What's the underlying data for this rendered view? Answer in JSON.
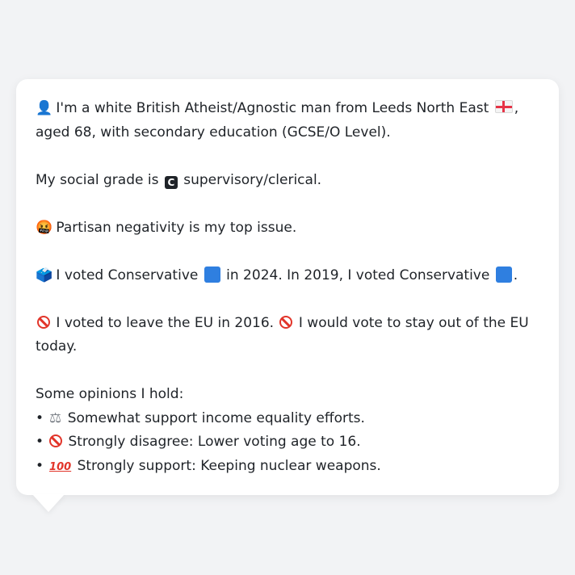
{
  "profile": {
    "intro_pre": "I'm a white British Atheist/Agnostic man from Leeds North East",
    "intro_post": ", aged 68, with secondary education (GCSE/O Level).",
    "social_grade_pre": "My social grade is",
    "social_grade_letter": "C",
    "social_grade_post": "supervisory/clerical.",
    "top_issue": "Partisan negativity is my top issue.",
    "vote_2024_pre": "I voted Conservative",
    "vote_2024_post": "in 2024. In 2019, I voted Conservative",
    "vote_end": ".",
    "eu_2016": "I voted to leave the EU in 2016.",
    "eu_today": "I would vote to stay out of the EU today.",
    "opinions_heading": "Some opinions I hold:",
    "opinions": [
      {
        "icon": "balance-scale-icon",
        "text": "Somewhat support income equality efforts."
      },
      {
        "icon": "prohibited-icon",
        "text": "Strongly disagree: Lower voting age to 16."
      },
      {
        "icon": "hundred-points-icon",
        "text": "Strongly support: Keeping nuclear weapons."
      }
    ]
  },
  "icons": {
    "person": "👤",
    "angry": "🤬",
    "ballot": "🗳️",
    "hundred": "100",
    "scales": "⚖"
  },
  "colors": {
    "background": "#f2f3f5",
    "card": "#ffffff",
    "text": "#1f2328",
    "conservative_blue": "#2f7fe0",
    "prohibited_red": "#e2352a"
  }
}
